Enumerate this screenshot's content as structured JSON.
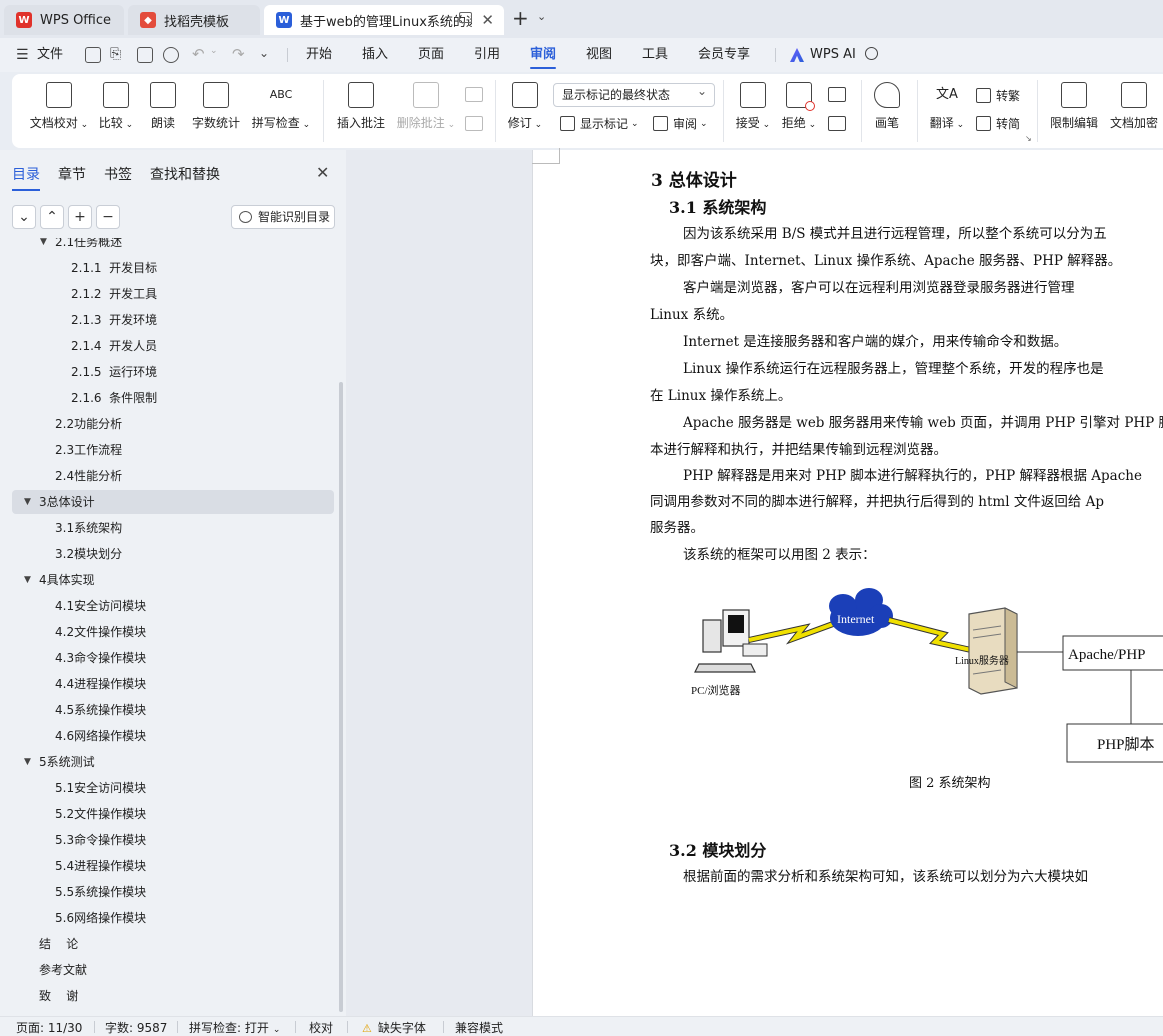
{
  "tabs": [
    {
      "label": "WPS Office"
    },
    {
      "label": "找稻壳模板"
    },
    {
      "label": "基于web的管理Linux系统的远"
    }
  ],
  "menu": {
    "file": "文件",
    "items": [
      "开始",
      "插入",
      "页面",
      "引用",
      "审阅",
      "视图",
      "工具",
      "会员专享"
    ],
    "active": "审阅",
    "wps_ai": "WPS AI"
  },
  "ribbon": {
    "doc_check": "文档校对",
    "compare": "比较",
    "read_aloud": "朗读",
    "word_count": "字数统计",
    "spell_check": "拼写检查",
    "insert_comment": "插入批注",
    "delete_comment": "删除批注",
    "revise": "修订",
    "mark_state": "显示标记的最终状态",
    "show_marks": "显示标记",
    "review": "审阅",
    "accept": "接受",
    "reject": "拒绝",
    "pen": "画笔",
    "translate": "翻译",
    "to_traditional": "转繁",
    "to_simplified": "转简",
    "restrict_edit": "限制编辑",
    "doc_encrypt": "文档加密"
  },
  "panel": {
    "tabs": [
      "目录",
      "章节",
      "书签",
      "查找和替换"
    ],
    "smart_btn": "智能识别目录",
    "toc": [
      {
        "label": "2.1任务概述",
        "level": 2,
        "arrow": "▼"
      },
      {
        "label": "2.1.1  开发目标",
        "level": 3
      },
      {
        "label": "2.1.2  开发工具",
        "level": 3
      },
      {
        "label": "2.1.3  开发环境",
        "level": 3
      },
      {
        "label": "2.1.4  开发人员",
        "level": 3
      },
      {
        "label": "2.1.5  运行环境",
        "level": 3
      },
      {
        "label": "2.1.6  条件限制",
        "level": 3
      },
      {
        "label": "2.2功能分析",
        "level": 2
      },
      {
        "label": "2.3工作流程",
        "level": 2
      },
      {
        "label": "2.4性能分析",
        "level": 2
      },
      {
        "label": "3总体设计",
        "level": 1,
        "arrow": "▼",
        "selected": true
      },
      {
        "label": "3.1系统架构",
        "level": 2
      },
      {
        "label": "3.2模块划分",
        "level": 2
      },
      {
        "label": "4具体实现",
        "level": 1,
        "arrow": "▼"
      },
      {
        "label": "4.1安全访问模块",
        "level": 2
      },
      {
        "label": "4.2文件操作模块",
        "level": 2
      },
      {
        "label": "4.3命令操作模块",
        "level": 2
      },
      {
        "label": "4.4进程操作模块",
        "level": 2
      },
      {
        "label": "4.5系统操作模块",
        "level": 2
      },
      {
        "label": "4.6网络操作模块",
        "level": 2
      },
      {
        "label": "5系统测试",
        "level": 1,
        "arrow": "▼"
      },
      {
        "label": "5.1安全访问模块",
        "level": 2
      },
      {
        "label": "5.2文件操作模块",
        "level": 2
      },
      {
        "label": "5.3命令操作模块",
        "level": 2
      },
      {
        "label": "5.4进程操作模块",
        "level": 2
      },
      {
        "label": "5.5系统操作模块",
        "level": 2
      },
      {
        "label": "5.6网络操作模块",
        "level": 2
      },
      {
        "label": "结    论",
        "level": 1
      },
      {
        "label": "参考文献",
        "level": 1
      },
      {
        "label": "致    谢",
        "level": 1
      }
    ]
  },
  "doc": {
    "h1": "3   总体设计",
    "h2a": "3.1  系统架构",
    "paras": [
      "因为该系统采用 B/S 模式并且进行远程管理，所以整个系统可以分为五",
      "块，即客户端、Internet、Linux 操作系统、Apache 服务器、PHP 解释器。",
      "客户端是浏览器，客户可以在远程利用浏览器登录服务器进行管理",
      "Linux 系统。",
      "Internet 是连接服务器和客户端的媒介，用来传输命令和数据。",
      "Linux 操作系统运行在远程服务器上，管理整个系统，开发的程序也是",
      "在 Linux 操作系统上。",
      "Apache 服务器是 web 服务器用来传输 web 页面，并调用 PHP 引擎对 PHP 脚",
      "本进行解释和执行，并把结果传输到远程浏览器。",
      "PHP 解释器是用来对 PHP 脚本进行解释执行的，PHP 解释器根据 Apache",
      "同调用参数对不同的脚本进行解释，并把执行后得到的 html 文件返回给 Ap",
      "服务器。",
      "该系统的框架可以用图 2 表示："
    ],
    "fig": {
      "pc_label": "PC/浏览器",
      "internet_label": "Internet",
      "server_label": "Linux服务器",
      "apache_label": "Apache/PHP",
      "php_label": "PHP脚本",
      "caption": "图 2  系统架构"
    },
    "h2b": "3.2  模块划分",
    "last_para": "根据前面的需求分析和系统架构可知，该系统可以划分为六大模块如"
  },
  "status": {
    "page": "页面: 11/30",
    "words": "字数: 9587",
    "spell": "拼写检查: 打开",
    "proof": "校对",
    "missing_font": "缺失字体",
    "compat": "兼容模式"
  },
  "colors": {
    "accent": "#2b5fd9",
    "wps_red": "#e0322b",
    "cloud": "#1b3fb8",
    "lightning": "#f0e000"
  }
}
